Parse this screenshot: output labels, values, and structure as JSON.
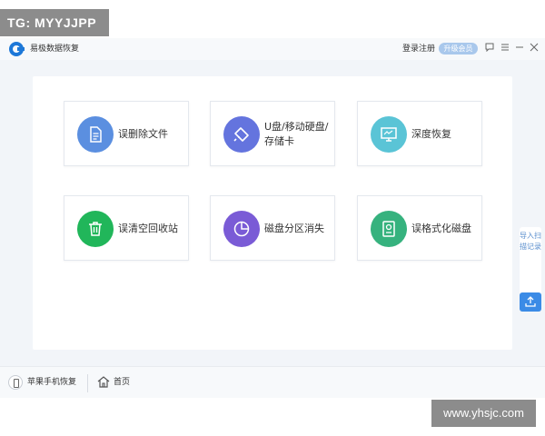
{
  "watermarks": {
    "top": "TG: MYYJJPP",
    "bottom": "www.yhsjc.com"
  },
  "titlebar": {
    "app_title": "易极数据恢复",
    "login": "登录注册",
    "upgrade": "升级会员"
  },
  "cards": [
    {
      "label": "误删除文件",
      "icon": "document-icon",
      "color": "#5b8fe0"
    },
    {
      "label": "U盘/移动硬盘/存储卡",
      "icon": "usb-drive-icon",
      "color": "#6474de"
    },
    {
      "label": "深度恢复",
      "icon": "monitor-icon",
      "color": "#5ac4d6"
    },
    {
      "label": "误清空回收站",
      "icon": "trash-icon",
      "color": "#21b65a"
    },
    {
      "label": "磁盘分区消失",
      "icon": "pie-chart-icon",
      "color": "#7a5bd6"
    },
    {
      "label": "误格式化磁盘",
      "icon": "hard-disk-icon",
      "color": "#36b27e"
    }
  ],
  "side_panel": {
    "text": "导入扫描记录"
  },
  "bottombar": {
    "apple_recovery": "苹果手机恢复",
    "home": "首页"
  },
  "colors": {
    "accent": "#3b8be6",
    "background": "#f2f5f9"
  }
}
